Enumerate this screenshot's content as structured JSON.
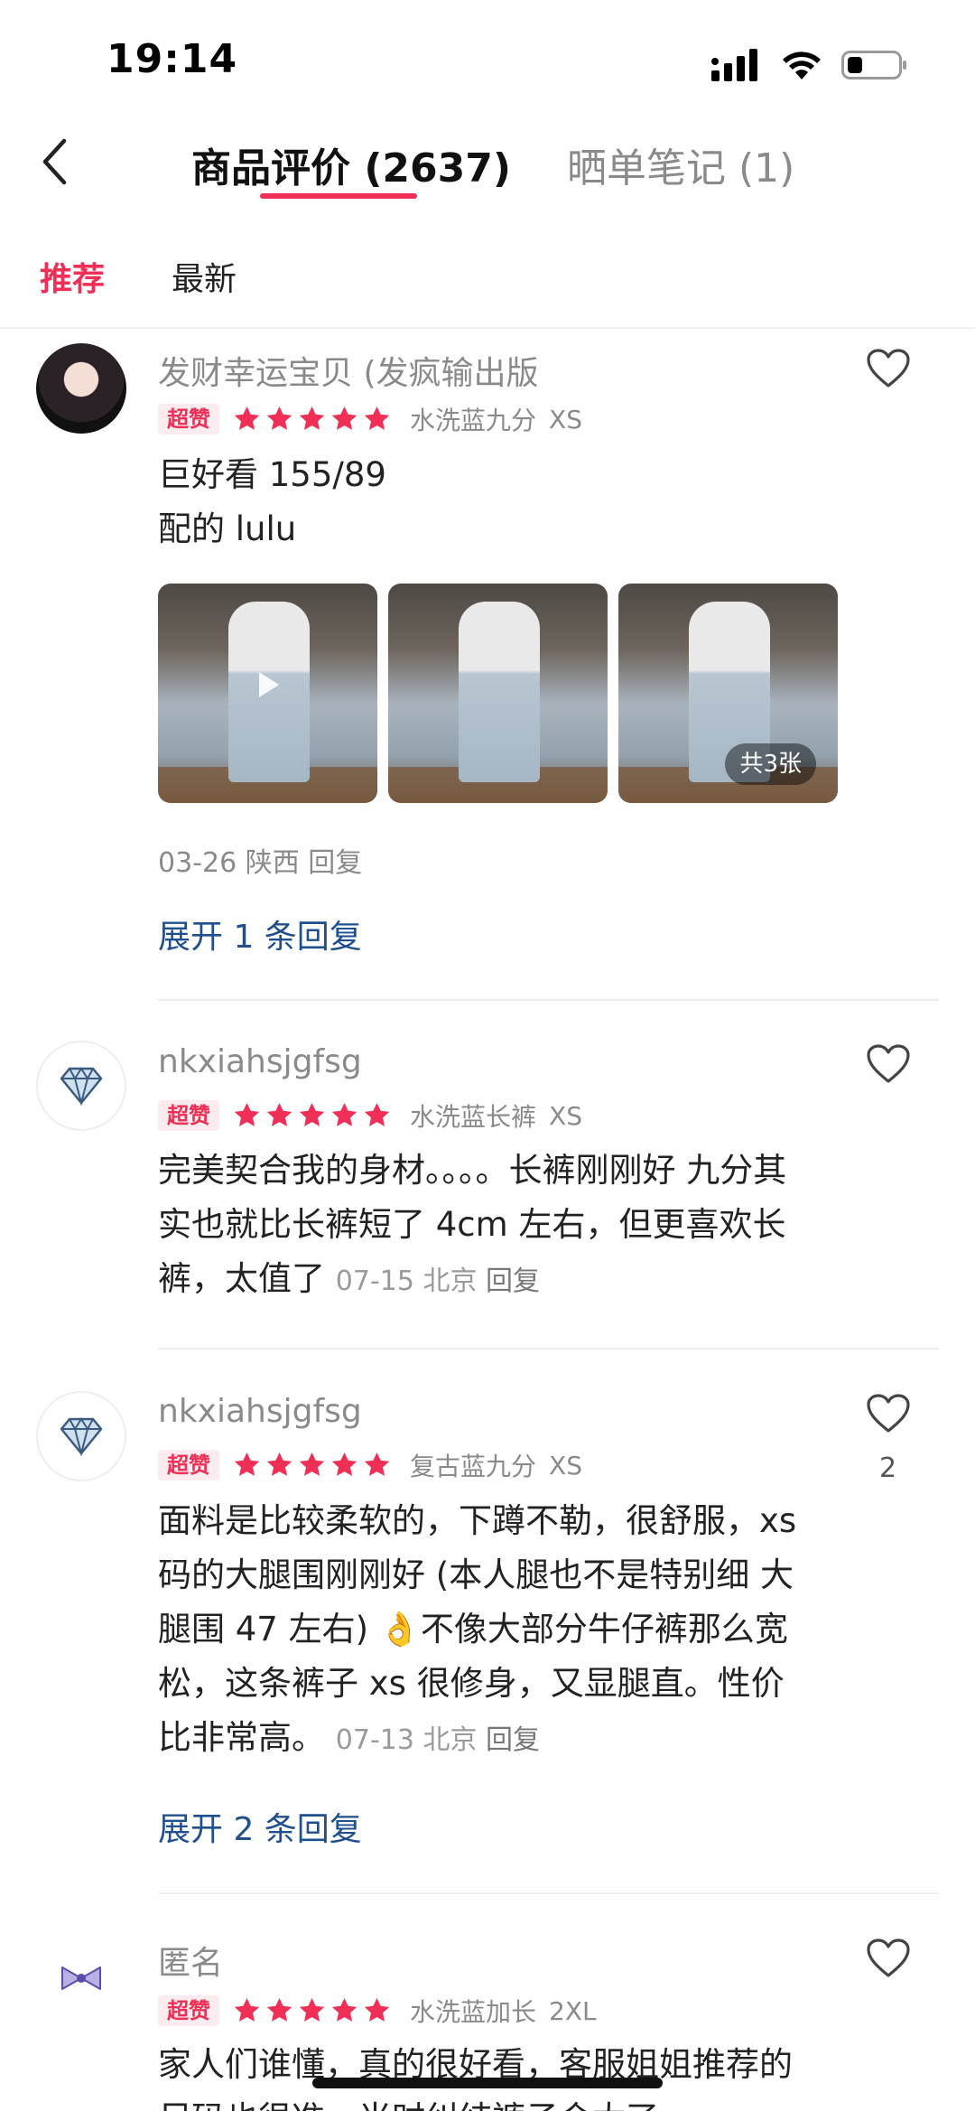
{
  "status": {
    "time": "19:14"
  },
  "header": {
    "tab_reviews": "商品评价 (2637)",
    "tab_notes": "晒单笔记 (1)"
  },
  "filters": {
    "recommended": "推荐",
    "latest": "最新"
  },
  "colors": {
    "accent": "#ef2f55",
    "link": "#1f4f8f",
    "star": "#ef2f55"
  },
  "reviews": [
    {
      "username": "发财幸运宝贝 (发疯输出版",
      "badge": "超赞",
      "rating": 5,
      "sku": "水洗蓝九分",
      "size": "XS",
      "content": "巨好看 155/89\n配的 lulu",
      "photo_count_label": "共3张",
      "date_line": "03-26  陕西  回复",
      "expand": "展开 1 条回复",
      "avatar_icon": "user-photo"
    },
    {
      "username": "nkxiahsjgfsg",
      "badge": "超赞",
      "rating": 5,
      "sku": "水洗蓝长裤",
      "size": "XS",
      "content": "完美契合我的身材。。。。长裤刚刚好 九分其实也就比长裤短了 4cm 左右，但更喜欢长裤，太值了",
      "date": "07-15",
      "location": "北京",
      "reply": "回复",
      "avatar_icon": "diamond-icon"
    },
    {
      "username": "nkxiahsjgfsg",
      "badge": "超赞",
      "rating": 5,
      "sku": "复古蓝九分",
      "size": "XS",
      "content": "面料是比较柔软的，下蹲不勒，很舒服，xs码的大腿围刚刚好 (本人腿也不是特别细 大腿围 47 左右) 👌不像大部分牛仔裤那么宽松，这条裤子 xs 很修身，又显腿直。性价比非常高。",
      "date": "07-13",
      "location": "北京",
      "reply": "回复",
      "likes": "2",
      "expand": "展开 2 条回复",
      "avatar_icon": "diamond-icon"
    },
    {
      "username": "匿名",
      "badge": "超赞",
      "rating": 5,
      "sku": "水洗蓝加长",
      "size": "2XL",
      "content": "家人们谁懂，真的很好看，客服姐姐推荐的尺码也很准，当时纠结裤子会太了",
      "avatar_icon": "bow-icon"
    }
  ]
}
